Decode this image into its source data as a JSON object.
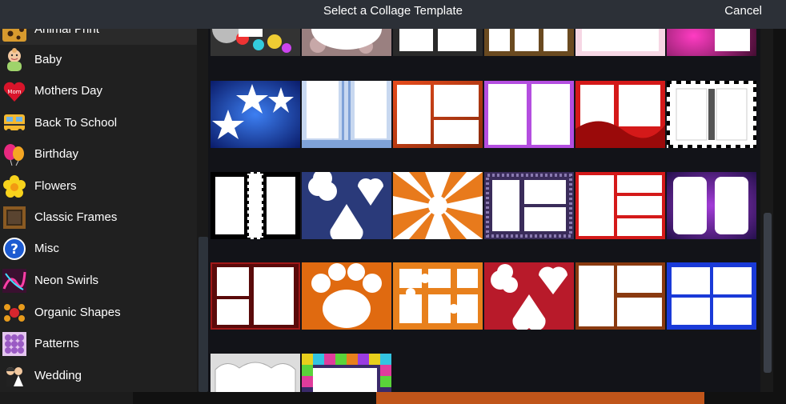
{
  "dialog": {
    "title": "Select a Collage Template",
    "cancel_label": "Cancel"
  },
  "sidebar": {
    "items": [
      {
        "label": "Animal Print",
        "icon": "animal-print-icon"
      },
      {
        "label": "Baby",
        "icon": "baby-icon"
      },
      {
        "label": "Mothers Day",
        "icon": "mom-heart-icon"
      },
      {
        "label": "Back To School",
        "icon": "school-bus-icon"
      },
      {
        "label": "Birthday",
        "icon": "balloons-icon"
      },
      {
        "label": "Flowers",
        "icon": "flower-icon"
      },
      {
        "label": "Classic Frames",
        "icon": "frame-icon"
      },
      {
        "label": "Misc",
        "icon": "question-mark-icon"
      },
      {
        "label": "Neon Swirls",
        "icon": "neon-swirl-icon"
      },
      {
        "label": "Organic Shapes",
        "icon": "organic-shapes-icon"
      },
      {
        "label": "Patterns",
        "icon": "dots-pattern-icon"
      },
      {
        "label": "Wedding",
        "icon": "wedding-couple-icon"
      }
    ],
    "icon_text": {
      "mothers_day": "Mom"
    }
  },
  "templates": [
    {
      "id": "r0c0",
      "style": "animal-collage"
    },
    {
      "id": "r0c1",
      "style": "bokeh-oval"
    },
    {
      "id": "r0c2",
      "style": "dark-split"
    },
    {
      "id": "r0c3",
      "style": "dark-quad"
    },
    {
      "id": "r0c4",
      "style": "pink-soft"
    },
    {
      "id": "r0c5",
      "style": "magenta-glow"
    },
    {
      "id": "r1c0",
      "style": "blue-stars"
    },
    {
      "id": "r1c1",
      "style": "blue-stripes"
    },
    {
      "id": "r1c2",
      "style": "orange-grid"
    },
    {
      "id": "r1c3",
      "style": "purple-split"
    },
    {
      "id": "r1c4",
      "style": "red-wave"
    },
    {
      "id": "r1c5",
      "style": "checker-frame"
    },
    {
      "id": "r2c0",
      "style": "bw-checker"
    },
    {
      "id": "r2c1",
      "style": "card-suits"
    },
    {
      "id": "r2c2",
      "style": "orange-burst"
    },
    {
      "id": "r2c3",
      "style": "purple-cross"
    },
    {
      "id": "r2c4",
      "style": "red-triple"
    },
    {
      "id": "r2c5",
      "style": "purple-splash"
    },
    {
      "id": "r3c0",
      "style": "red-grunge"
    },
    {
      "id": "r3c1",
      "style": "paw-print"
    },
    {
      "id": "r3c2",
      "style": "puzzle-pieces"
    },
    {
      "id": "r3c3",
      "style": "swirl-suits"
    },
    {
      "id": "r3c4",
      "style": "fire-triple"
    },
    {
      "id": "r3c5",
      "style": "blue-glow-quad"
    },
    {
      "id": "r4c0",
      "style": "grey-organic"
    },
    {
      "id": "r4c1",
      "style": "tetris"
    }
  ],
  "colors": {
    "titlebar": "#2c3037",
    "sidebar": "#202020",
    "grid_bg": "#121318"
  }
}
